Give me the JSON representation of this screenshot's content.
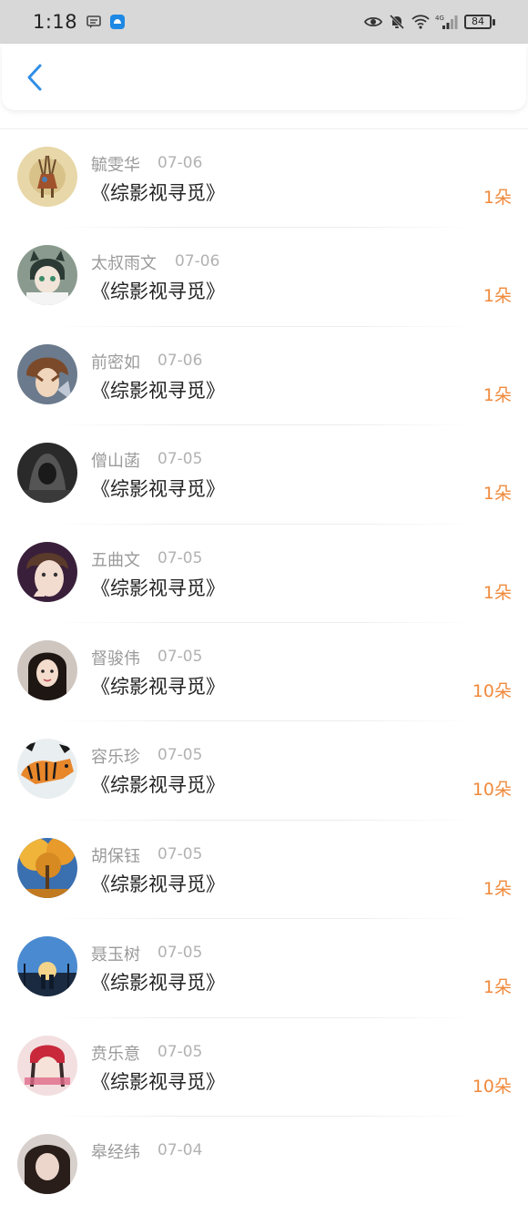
{
  "status_bar": {
    "time": "1:18",
    "battery": "84",
    "network": "4G"
  },
  "header": {
    "back_icon": "chevron-left-icon"
  },
  "colors": {
    "accent": "#2f8fe6",
    "amount": "#f08a3c",
    "status_bar_bg": "#d8d8d8"
  },
  "list": {
    "items": [
      {
        "name": "毓雯华",
        "date": "07-06",
        "title": "《综影视寻觅》",
        "amount": "1朵"
      },
      {
        "name": "太叔雨文",
        "date": "07-06",
        "title": "《综影视寻觅》",
        "amount": "1朵"
      },
      {
        "name": "前密如",
        "date": "07-06",
        "title": "《综影视寻觅》",
        "amount": "1朵"
      },
      {
        "name": "僧山菡",
        "date": "07-05",
        "title": "《综影视寻觅》",
        "amount": "1朵"
      },
      {
        "name": "五曲文",
        "date": "07-05",
        "title": "《综影视寻觅》",
        "amount": "1朵"
      },
      {
        "name": "督骏伟",
        "date": "07-05",
        "title": "《综影视寻觅》",
        "amount": "10朵"
      },
      {
        "name": "容乐珍",
        "date": "07-05",
        "title": "《综影视寻觅》",
        "amount": "10朵"
      },
      {
        "name": "胡保钰",
        "date": "07-05",
        "title": "《综影视寻觅》",
        "amount": "1朵"
      },
      {
        "name": "聂玉树",
        "date": "07-05",
        "title": "《综影视寻觅》",
        "amount": "1朵"
      },
      {
        "name": "贲乐意",
        "date": "07-05",
        "title": "《综影视寻觅》",
        "amount": "10朵"
      },
      {
        "name": "皋经纬",
        "date": "07-04",
        "title": "",
        "amount": ""
      }
    ]
  }
}
